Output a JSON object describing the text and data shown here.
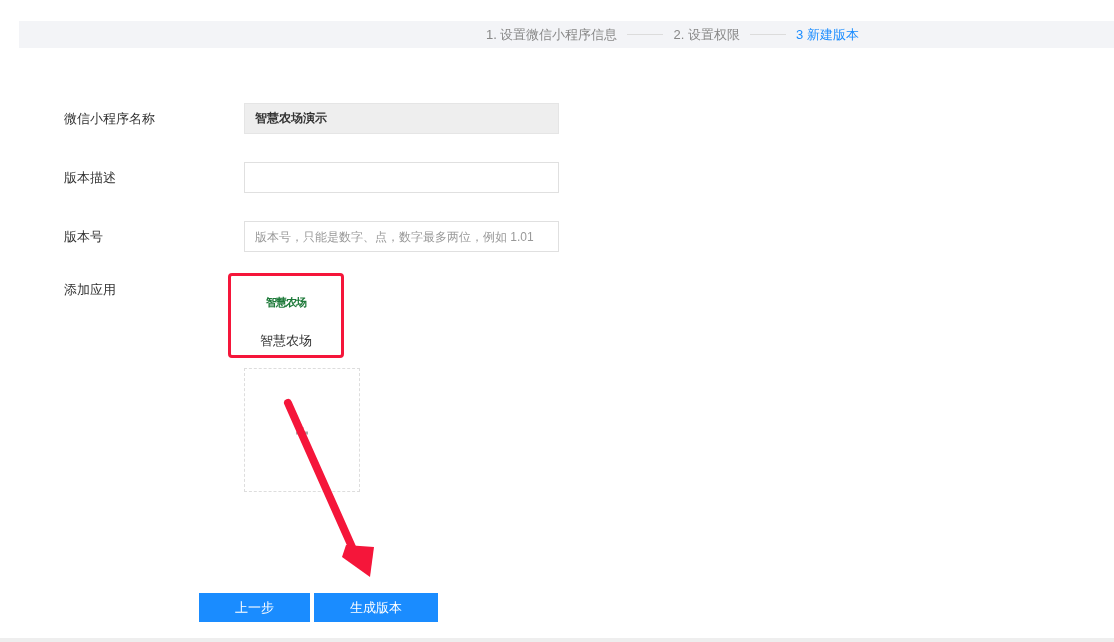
{
  "steps": [
    {
      "label": "1. 设置微信小程序信息",
      "selected": false
    },
    {
      "label": "2. 设置权限",
      "selected": false
    },
    {
      "label": "3 新建版本",
      "selected": true
    }
  ],
  "form": [
    {
      "label": "微信小程序名称",
      "value": "智慧农场演示",
      "disabled": true
    },
    {
      "label": "版本描述"
    },
    {
      "label": "版本号",
      "placeholder": "版本号，只能是数字、点，数字最多两位，例如 1.01"
    }
  ],
  "apps": {
    "label": "添加应用",
    "items": [
      {
        "logo": "智慧农场",
        "name": "智慧农场",
        "highlighted": true
      }
    ]
  },
  "buttons": [
    {
      "label": "上一步"
    },
    {
      "label": "生成版本"
    }
  ]
}
